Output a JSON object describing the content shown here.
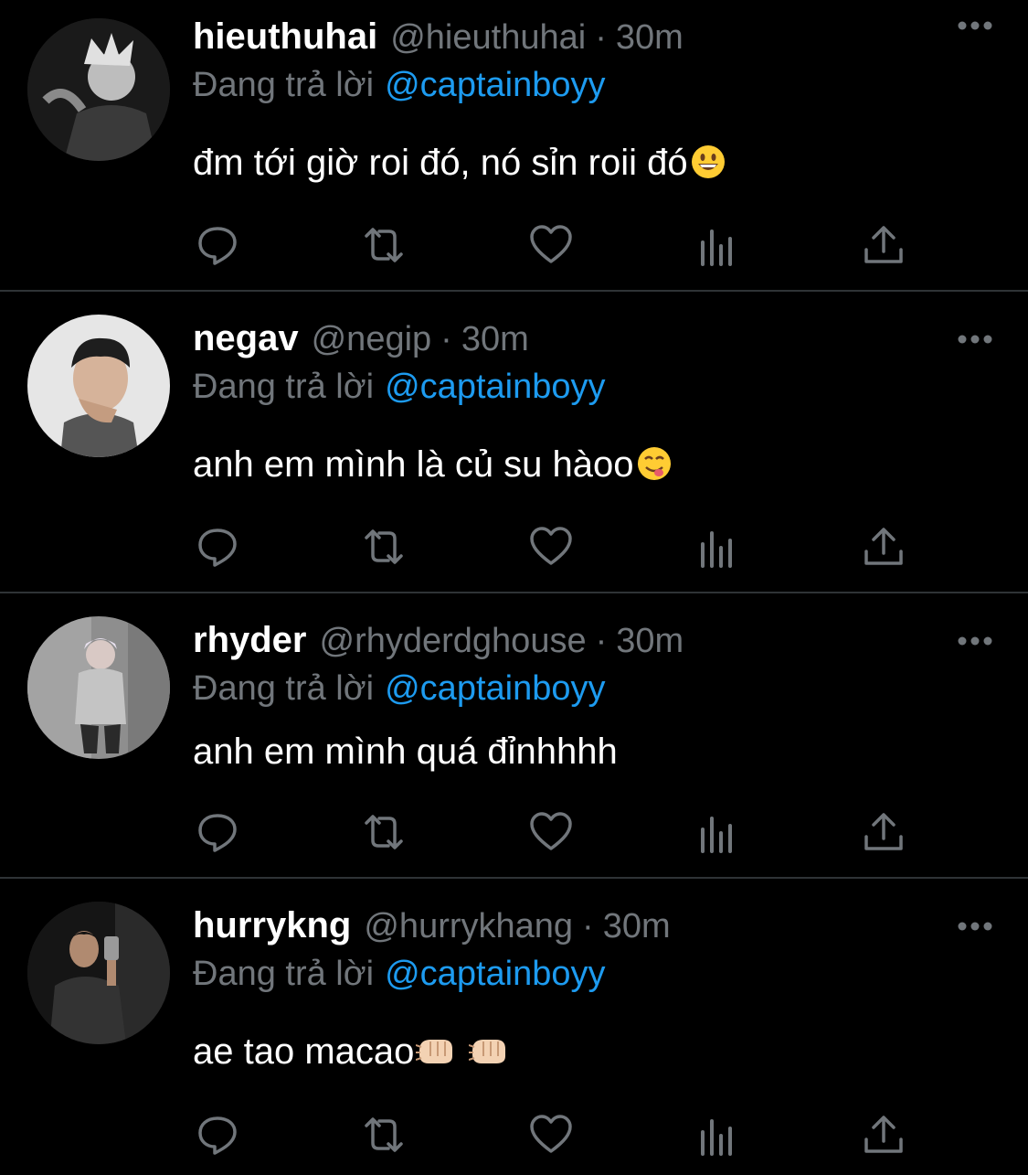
{
  "tweets": [
    {
      "name": "hieuthuhai",
      "handle": "@hieuthuhai",
      "time": "30m",
      "reply_prefix": "Đang trả lời",
      "reply_to": "@captainboyy",
      "text": "đm tới giờ roi đó, nó sỉn roii đó",
      "emoji": [
        "grinning-face"
      ]
    },
    {
      "name": "negav",
      "handle": "@negip",
      "time": "30m",
      "reply_prefix": "Đang trả lời",
      "reply_to": "@captainboyy",
      "text": "anh em mình là củ su hàoo",
      "emoji": [
        "face-savoring-food"
      ]
    },
    {
      "name": "rhyder",
      "handle": "@rhyderdghouse",
      "time": "30m",
      "reply_prefix": "Đang trả lời",
      "reply_to": "@captainboyy",
      "text": "anh em mình quá đỉnhhhh",
      "emoji": []
    },
    {
      "name": "hurrykng",
      "handle": "@hurrykhang",
      "time": "30m",
      "reply_prefix": "Đang trả lời",
      "reply_to": "@captainboyy",
      "text": "ae tao macao",
      "emoji": [
        "fist-bump",
        "fist-bump"
      ]
    }
  ],
  "separator": "·",
  "action_icons": [
    "reply-icon",
    "retweet-icon",
    "like-icon",
    "views-icon",
    "share-icon"
  ],
  "colors": {
    "background": "#000000",
    "name": "#ffffff",
    "secondary": "#71767b",
    "link": "#1d9bf0",
    "divider": "#2f3336"
  }
}
